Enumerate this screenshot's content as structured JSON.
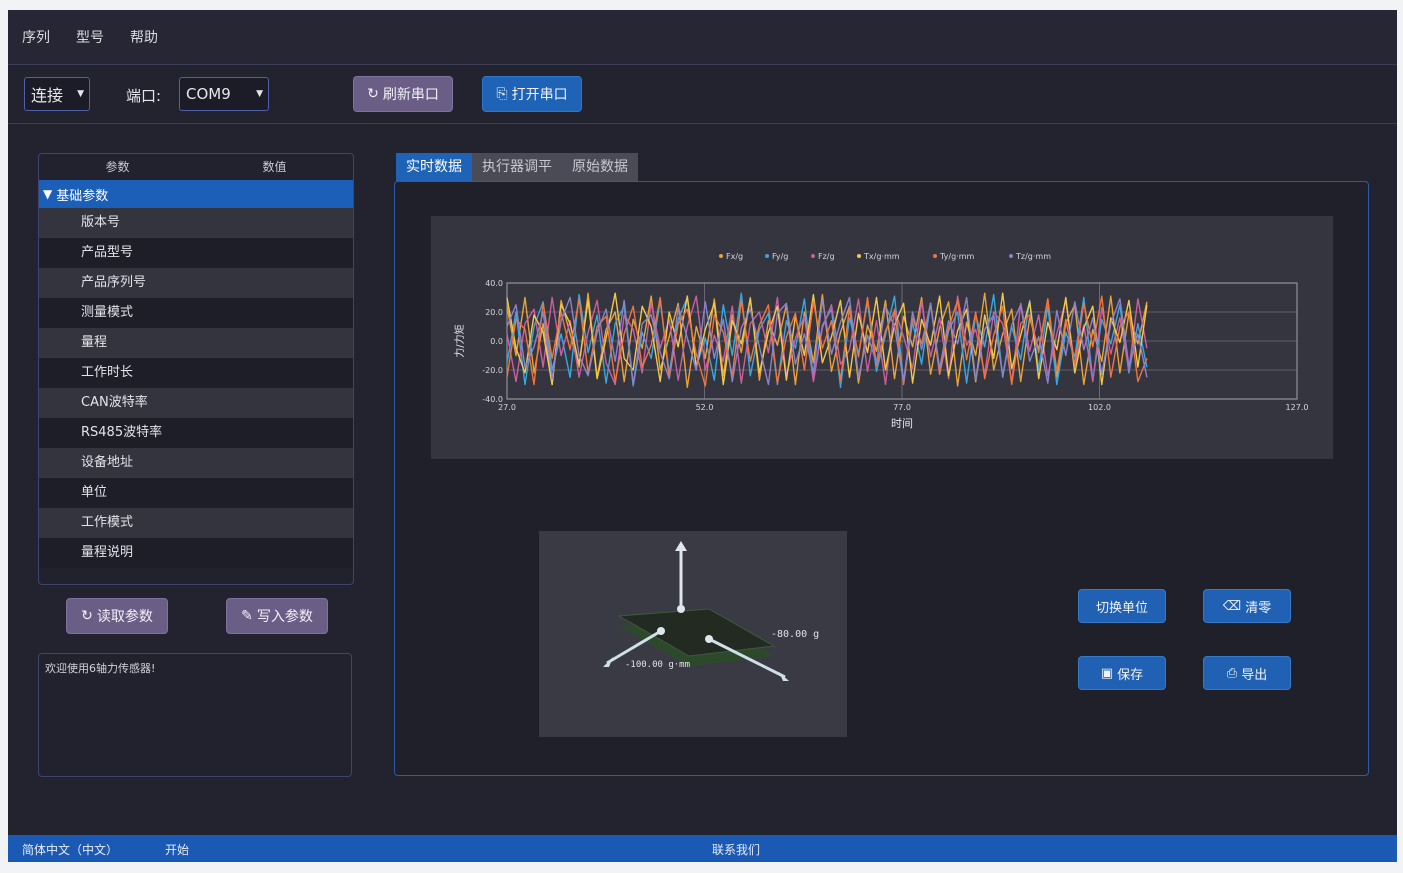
{
  "menu": [
    "序列",
    "型号",
    "帮助"
  ],
  "toolbar": {
    "connect_value": "连接",
    "port_label": "端口:",
    "port_value": "COM9",
    "refresh_label": "刷新串口",
    "open_label": "打开串口"
  },
  "tree": {
    "col_param": "参数",
    "col_value": "数值",
    "parent": "基础参数",
    "items": [
      "版本号",
      "产品型号",
      "产品序列号",
      "测量模式",
      "量程",
      "工作时长",
      "CAN波特率",
      "RS485波特率",
      "设备地址",
      "单位",
      "工作模式",
      "量程说明"
    ]
  },
  "buttons": {
    "read_params": "读取参数",
    "write_params": "写入参数",
    "switch_unit": "切换单位",
    "clear": "清零",
    "save": "保存",
    "export": "导出"
  },
  "log_text": "欢迎使用6轴力传感器!",
  "tabs": [
    "实时数据",
    "执行器调平",
    "原始数据"
  ],
  "force_labels": {
    "force": "-80.00 g",
    "torque": "-100.00 g·mm"
  },
  "status": {
    "left": "简体中文（中文）",
    "middle": "开始",
    "center": "联系我们"
  },
  "colors": {
    "fx": "#e8a23a",
    "fy": "#36a8e0",
    "fz": "#c95fa0",
    "tx": "#f2c84b",
    "ty": "#f0743c",
    "tz": "#8a83c9"
  },
  "chart_data": {
    "type": "line",
    "title": "",
    "xlabel": "时间",
    "ylabel": "力/力矩",
    "xlim": [
      27.0,
      127.0
    ],
    "ylim": [
      -40.0,
      40.0
    ],
    "xticks": [
      "27.0",
      "52.0",
      "77.0",
      "102.0",
      "127.0"
    ],
    "yticks": [
      "40.0",
      "20.0",
      "0.0",
      "-20.0",
      "-40.0"
    ],
    "legend_position": "top",
    "series": [
      {
        "name": "Fx/g",
        "color": "#e8a23a",
        "values": [
          24,
          -10,
          30,
          -22,
          12,
          -30,
          28,
          5,
          -18,
          33,
          -25,
          8,
          20,
          -28,
          15,
          -5,
          31,
          -20,
          3,
          26,
          -32,
          10,
          -12,
          29,
          -24,
          18,
          -8,
          30,
          -27,
          14,
          -3,
          25,
          -30,
          20,
          -15,
          32,
          -21,
          6,
          24,
          -29,
          11,
          -7,
          28,
          -26,
          17,
          -4,
          30,
          -23,
          9,
          27,
          -31,
          13,
          -10,
          33,
          -20,
          5,
          22,
          -28,
          16,
          -6,
          29,
          -25,
          12,
          25,
          -30,
          8,
          -14,
          31,
          -22,
          19,
          -2,
          27
        ]
      },
      {
        "name": "Fy/g",
        "color": "#36a8e0",
        "values": [
          -15,
          20,
          -30,
          10,
          27,
          -20,
          5,
          -25,
          32,
          -8,
          18,
          -29,
          12,
          24,
          -31,
          6,
          -12,
          28,
          -22,
          15,
          30,
          -18,
          2,
          -27,
          25,
          -10,
          33,
          -24,
          8,
          19,
          -30,
          14,
          -5,
          29,
          -26,
          11,
          22,
          -32,
          16,
          -9,
          27,
          -21,
          4,
          31,
          -28,
          13,
          -16,
          26,
          -23,
          7,
          20,
          -29,
          18,
          -4,
          32,
          -25,
          10,
          -13,
          28,
          -20,
          24,
          -30,
          6,
          -11,
          30,
          -27,
          15,
          -2,
          25,
          -22,
          12,
          -18
        ]
      },
      {
        "name": "Fz/g",
        "color": "#c95fa0",
        "values": [
          5,
          -28,
          12,
          22,
          -18,
          30,
          -10,
          14,
          -25,
          6,
          28,
          -15,
          -30,
          18,
          8,
          -22,
          26,
          -5,
          15,
          -27,
          10,
          31,
          -20,
          4,
          -14,
          24,
          -29,
          12,
          20,
          -8,
          30,
          -24,
          2,
          17,
          -28,
          9,
          25,
          -16,
          -6,
          29,
          -21,
          14,
          -30,
          22,
          3,
          -19,
          27,
          -11,
          16,
          -26,
          31,
          -3,
          8,
          -23,
          20,
          12,
          -29,
          26,
          -7,
          18,
          -24,
          5,
          28,
          -17,
          11,
          -28,
          23,
          -9,
          16,
          -20,
          29,
          -5
        ]
      },
      {
        "name": "Tx/g·mm",
        "color": "#f2c84b",
        "values": [
          30,
          -5,
          -22,
          18,
          6,
          -30,
          25,
          12,
          -16,
          28,
          -26,
          2,
          33,
          -12,
          -20,
          24,
          10,
          -28,
          20,
          -4,
          31,
          -18,
          8,
          26,
          -30,
          14,
          -2,
          29,
          -22,
          6,
          24,
          -27,
          17,
          -10,
          32,
          -15,
          3,
          28,
          -25,
          19,
          -8,
          30,
          -20,
          11,
          26,
          -29,
          15,
          -3,
          31,
          -24,
          7,
          22,
          -28,
          18,
          -12,
          33,
          -19,
          4,
          27,
          -26,
          13,
          -6,
          30,
          -22,
          9,
          24,
          -30,
          16,
          -1,
          28,
          -18,
          25
        ]
      },
      {
        "name": "Ty/g·mm",
        "color": "#f0743c",
        "values": [
          -25,
          15,
          8,
          -30,
          26,
          -12,
          20,
          -6,
          29,
          -22,
          10,
          17,
          -28,
          5,
          24,
          -18,
          -3,
          30,
          -26,
          12,
          22,
          -9,
          -31,
          18,
          6,
          -24,
          28,
          -14,
          11,
          25,
          -29,
          3,
          19,
          -20,
          27,
          -5,
          14,
          -27,
          23,
          -11,
          30,
          -17,
          7,
          21,
          -30,
          16,
          -2,
          26,
          -23,
          9,
          28,
          -13,
          20,
          -26,
          4,
          24,
          -30,
          12,
          18,
          -8,
          29,
          -21,
          15,
          -16,
          26,
          -4,
          31,
          -25,
          10,
          20,
          -28,
          -12
        ]
      },
      {
        "name": "Tz/g·mm",
        "color": "#8a83c9",
        "values": [
          10,
          25,
          -18,
          -4,
          20,
          -26,
          14,
          30,
          -10,
          -24,
          6,
          22,
          -14,
          28,
          -30,
          12,
          18,
          -8,
          -26,
          24,
          2,
          -20,
          27,
          -12,
          15,
          -28,
          9,
          22,
          -4,
          -30,
          19,
          26,
          -16,
          5,
          -22,
          28,
          -9,
          13,
          30,
          -25,
          4,
          -15,
          24,
          10,
          -28,
          20,
          -6,
          26,
          -19,
          14,
          -2,
          30,
          -27,
          8,
          18,
          -24,
          11,
          25,
          -14,
          3,
          -29,
          21,
          -10,
          27,
          -6,
          16,
          -23,
          12,
          29,
          -17,
          5,
          -25
        ]
      }
    ]
  }
}
